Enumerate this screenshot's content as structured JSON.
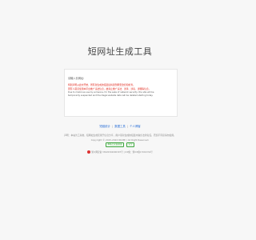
{
  "page": {
    "title": "短网址生成工具"
  },
  "form": {
    "label": "请输入长网址:",
    "notice_red_1": "特别声明从此时开始，所有新生成的短链接将受到网安监控和检查。",
    "notice_red_2": "因有人恶意使用本平台推广违法信息，故禁止推广违法、涉黄、涉毒、涉赌等信息。",
    "notice_en_1": "Due to malicious use by someone, for the sake of network security, the site will be",
    "notice_en_2": "temporarily suspended and the illegal website data will be deleted starting today."
  },
  "links": {
    "item1": "短链统计",
    "item2": "数据工具",
    "item3": "个人博客"
  },
  "footer": {
    "line1": "声明：本站为工具类，短网址生成仅用于信息分享，用户需对生成的短链内容负法律责任，若您不同意请勿使用。",
    "line2": "Copyright © 2015-2024 RKUMI  |  All Right Reserved.",
    "badge1": "本站已安装备案",
    "badge2": "安全",
    "icp": "浙公网安备 33020302000307号 | ICP备：浙ICP备17001334号"
  },
  "colors": {
    "warning": "#e0261b",
    "link": "#2a6fd6",
    "badge": "#3ca53c"
  }
}
